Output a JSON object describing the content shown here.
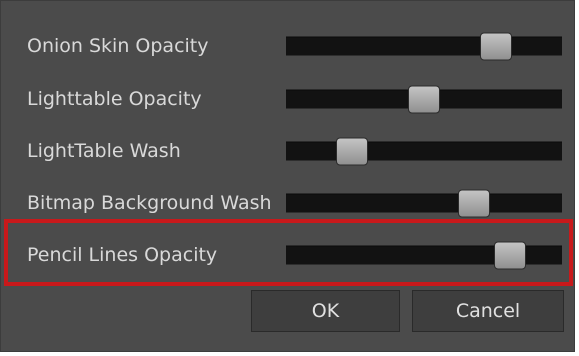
{
  "dialog": {
    "sliders": [
      {
        "label": "Onion Skin Opacity",
        "value_pct": 76
      },
      {
        "label": "Lighttable Opacity",
        "value_pct": 50
      },
      {
        "label": "LightTable Wash",
        "value_pct": 24
      },
      {
        "label": "Bitmap Background Wash",
        "value_pct": 68
      },
      {
        "label": "Pencil Lines Opacity",
        "value_pct": 81
      }
    ],
    "highlighted_row": "Pencil Lines Opacity",
    "buttons": {
      "ok_label": "OK",
      "cancel_label": "Cancel"
    }
  },
  "colors": {
    "panel_background": "#4b4b4b",
    "track": "#121212",
    "highlight_border": "#c8191b",
    "label_text": "#d9d9d9"
  }
}
